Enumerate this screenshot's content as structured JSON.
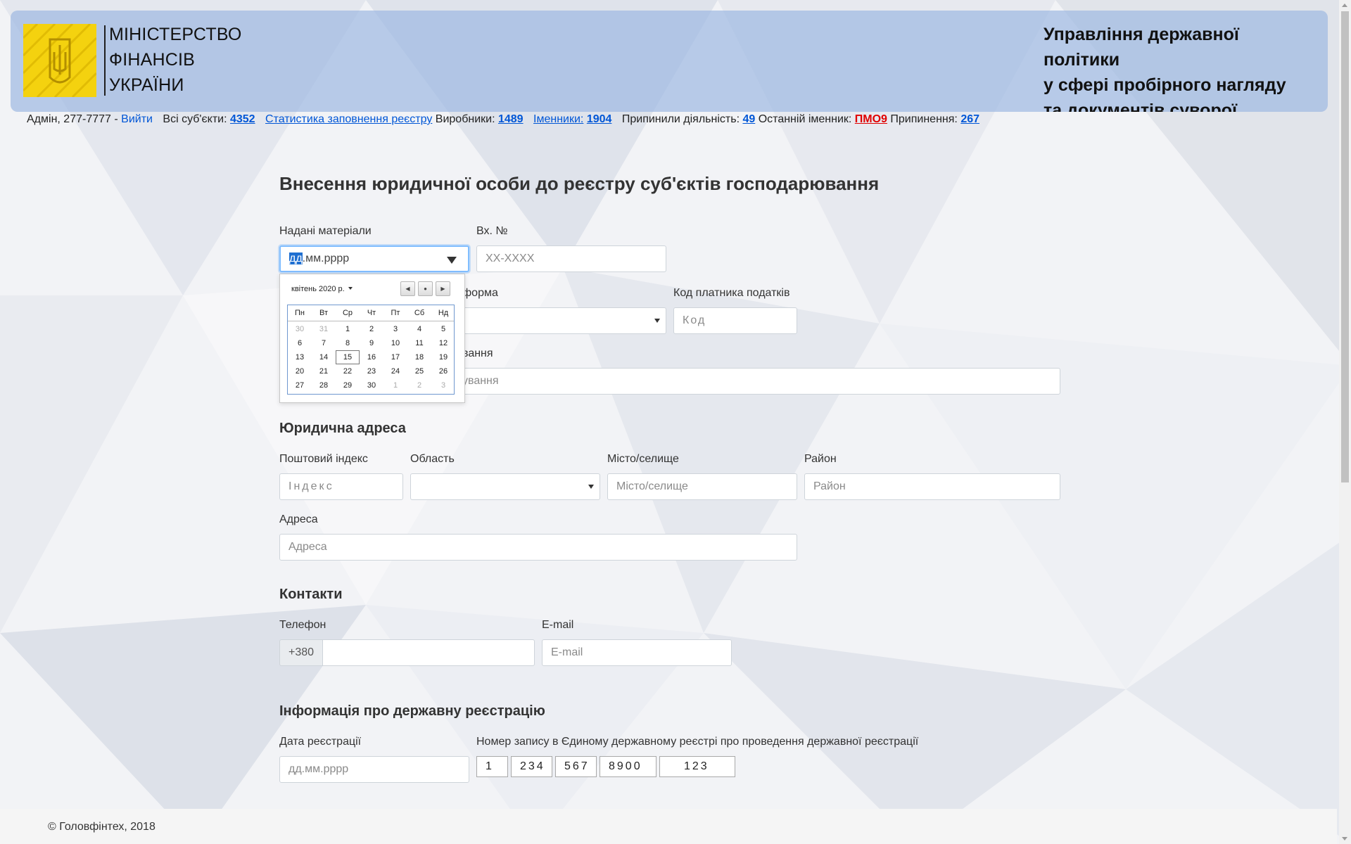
{
  "header": {
    "ministry_lines": [
      "МІНІСТЕРСТВО",
      "ФІНАНСІВ",
      "УКРАЇНИ"
    ],
    "dept_lines": [
      "Управління державної політики",
      "у сфері пробірного нагляду",
      "та документів суворої звітності"
    ],
    "brand_yellow": "#f4d20f",
    "brand_blue_bg": "#a0bae2"
  },
  "userbar": {
    "user": "Адмін, 277-7777 -",
    "logout": "Вийти",
    "all_subjects_label": "Всі суб'єкти:",
    "all_subjects_count": "4352",
    "stats_link": "Статистика заповнення реєстру",
    "producers_label": "Виробники:",
    "producers_count": "1489",
    "markers_label": "Іменники:",
    "markers_count": "1904",
    "stopped_label": "Припинили діяльність:",
    "stopped_count": "49",
    "last_marker_label": "Останній іменник:",
    "last_marker_value": "ПМО9",
    "terminations_label": "Припинення:",
    "terminations_count": "267"
  },
  "form": {
    "title": "Внесення юридичної особи до реєстру суб'єктів господарювання",
    "materials_label": "Надані матеріали",
    "materials_value_highlight": "дд",
    "materials_value_rest": ".мм.рррр",
    "incoming_label": "Вх. №",
    "incoming_placeholder": "ХХ-ХХХХ",
    "legal_form_label_partial": "форма",
    "tax_code_label": "Код платника податків",
    "tax_code_placeholder": "Код",
    "name_label_partial": "вання",
    "name_placeholder_partial": "ування",
    "address_section": "Юридична адреса",
    "postal_label": "Поштовий індекс",
    "postal_placeholder": "Індекс",
    "region_label": "Область",
    "city_label": "Місто/селище",
    "city_placeholder": "Місто/селище",
    "district_label": "Район",
    "district_placeholder": "Район",
    "address_label": "Адреса",
    "address_placeholder": "Адреса",
    "contacts_section": "Контакти",
    "phone_label": "Телефон",
    "phone_prefix": "+380",
    "email_label": "E-mail",
    "email_placeholder": "E-mail",
    "registration_section": "Інформація про державну реєстрацію",
    "reg_date_label": "Дата реєстрації",
    "reg_date_placeholder": "дд.мм.рррр",
    "record_label": "Номер запису в Єдиному державному реєстрі про проведення державної реєстрації",
    "record_segments": [
      "1",
      "234",
      "567",
      "8900",
      "123"
    ]
  },
  "calendar": {
    "month_label": "квітень 2020 р.",
    "prev_glyph": "◀",
    "today_glyph": "●",
    "next_glyph": "▶",
    "weekdays": [
      "Пн",
      "Вт",
      "Ср",
      "Чт",
      "Пт",
      "Сб",
      "Нд"
    ],
    "weeks": [
      [
        "30",
        "31",
        "1",
        "2",
        "3",
        "4",
        "5"
      ],
      [
        "6",
        "7",
        "8",
        "9",
        "10",
        "11",
        "12"
      ],
      [
        "13",
        "14",
        "15",
        "16",
        "17",
        "18",
        "19"
      ],
      [
        "20",
        "21",
        "22",
        "23",
        "24",
        "25",
        "26"
      ],
      [
        "27",
        "28",
        "29",
        "30",
        "1",
        "2",
        "3"
      ]
    ],
    "today": "15"
  },
  "footer": {
    "copyright": "© Головфінтех, 2018"
  }
}
